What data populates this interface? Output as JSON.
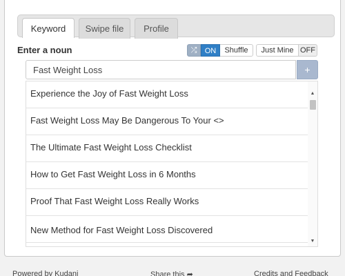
{
  "tabs": [
    {
      "label": "Keyword",
      "active": true
    },
    {
      "label": "Swipe file",
      "active": false
    },
    {
      "label": "Profile",
      "active": false
    }
  ],
  "form": {
    "noun_label": "Enter a noun",
    "input_value": "Fast Weight Loss",
    "add_button_label": "+"
  },
  "toggles": {
    "shuffle_state": "ON",
    "shuffle_label": "Shuffle",
    "just_mine_label": "Just Mine",
    "just_mine_state": "OFF"
  },
  "results": [
    "Experience the Joy of Fast Weight Loss",
    "Fast Weight Loss May Be Dangerous To Your <>",
    "The Ultimate Fast Weight Loss Checklist",
    "How to Get Fast Weight Loss in 6 Months",
    "Proof That Fast Weight Loss Really Works",
    "New Method for Fast Weight Loss Discovered"
  ],
  "footer": {
    "powered": "Powered by Kudani",
    "share": "Share this",
    "credits": "Credits and Feedback"
  },
  "icons": {
    "shuffle": "shuffle-icon",
    "scroll_up": "scroll-up-arrow-icon",
    "scroll_down": "scroll-down-arrow-icon",
    "share": "share-arrow-icon"
  },
  "colors": {
    "toggle_on": "#2f7fc6",
    "add_button": "#a9b8cf"
  }
}
